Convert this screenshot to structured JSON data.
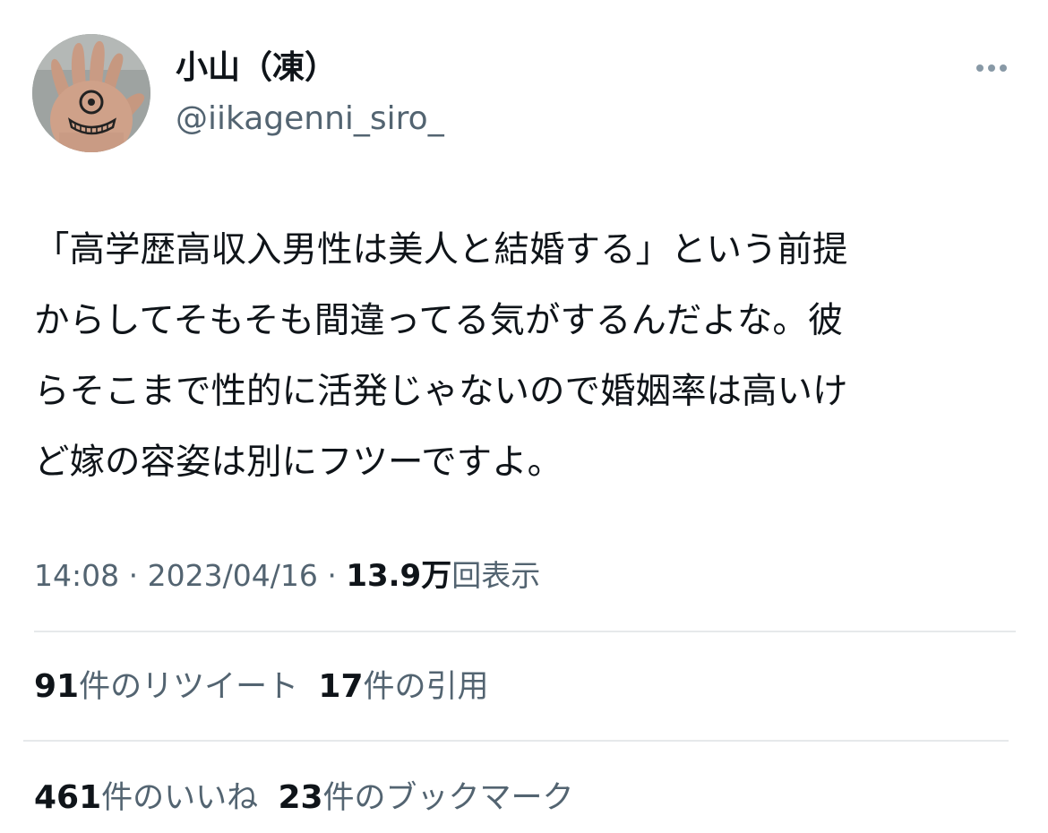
{
  "author": {
    "display_name": "小山（凍）",
    "handle": "@iikagenni_siro_",
    "avatar_icon": "hand-with-eye-drawing-avatar"
  },
  "menu": {
    "more_icon": "more-horizontal-icon"
  },
  "tweet": {
    "lines": [
      "「高学歴高収入男性は美人と結婚する」という前提",
      "からしてそもそも間違ってる気がするんだよな。彼",
      "らそこまで性的に活発じゃないので婚姻率は高いけ",
      "ど嫁の容姿は別にフツーですよ。"
    ]
  },
  "meta": {
    "time": "14:08",
    "separator": "·",
    "date": "2023/04/16",
    "views_count": "13.9万",
    "views_label": "回表示"
  },
  "stats": {
    "retweets": {
      "count": "91",
      "label": "件のリツイート"
    },
    "quotes": {
      "count": "17",
      "label": "件の引用"
    },
    "likes": {
      "count": "461",
      "label": "件のいいね"
    },
    "bookmarks": {
      "count": "23",
      "label": "件のブックマーク"
    }
  },
  "colors": {
    "text_primary": "#0f1419",
    "text_secondary": "#536471",
    "divider": "#e6e9eb"
  }
}
